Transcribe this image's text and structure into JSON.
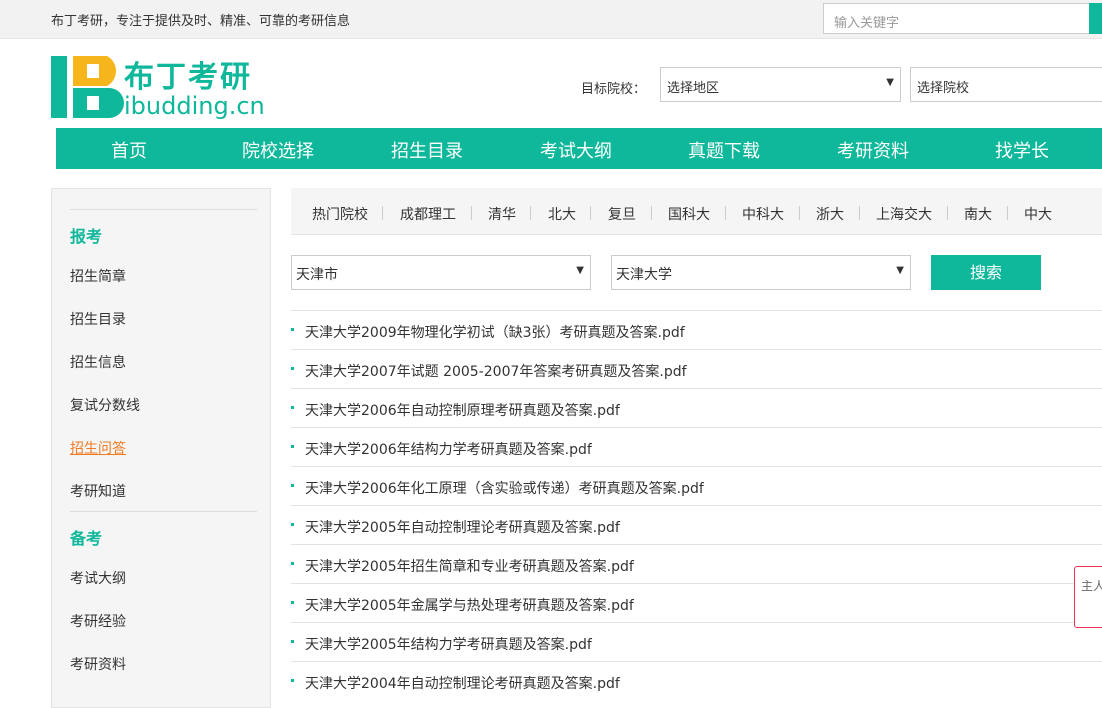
{
  "topbar": {
    "slogan": "布丁考研，专注于提供及时、精准、可靠的考研信息",
    "search_placeholder": "输入关键字"
  },
  "logo": {
    "cn": "布丁考研",
    "en": "ibudding.cn"
  },
  "target": {
    "label": "目标院校：",
    "region": "选择地区",
    "school": "选择院校"
  },
  "nav": [
    "首页",
    "院校选择",
    "招生目录",
    "考试大纲",
    "真题下载",
    "考研资料",
    "找学长"
  ],
  "sidebar": {
    "sec1": "报考",
    "links1": [
      "招生简章",
      "招生目录",
      "招生信息",
      "复试分数线",
      "招生问答",
      "考研知道"
    ],
    "sec2": "备考",
    "links2": [
      "考试大纲",
      "考研经验",
      "考研资料"
    ]
  },
  "hot": [
    "热门院校",
    "成都理工",
    "清华",
    "北大",
    "复旦",
    "国科大",
    "中科大",
    "浙大",
    "上海交大",
    "南大",
    "中大"
  ],
  "filter": {
    "city": "天津市",
    "university": "天津大学",
    "search": "搜索"
  },
  "files": [
    "天津大学2009年物理化学初试（缺3张）考研真题及答案.pdf",
    "天津大学2007年试题 2005-2007年答案考研真题及答案.pdf",
    "天津大学2006年自动控制原理考研真题及答案.pdf",
    "天津大学2006年结构力学考研真题及答案.pdf",
    "天津大学2006年化工原理（含实验或传递）考研真题及答案.pdf",
    "天津大学2005年自动控制理论考研真题及答案.pdf",
    "天津大学2005年招生简章和专业考研真题及答案.pdf",
    "天津大学2005年金属学与热处理考研真题及答案.pdf",
    "天津大学2005年结构力学考研真题及答案.pdf",
    "天津大学2004年自动控制理论考研真题及答案.pdf"
  ],
  "float_tip": "主人"
}
